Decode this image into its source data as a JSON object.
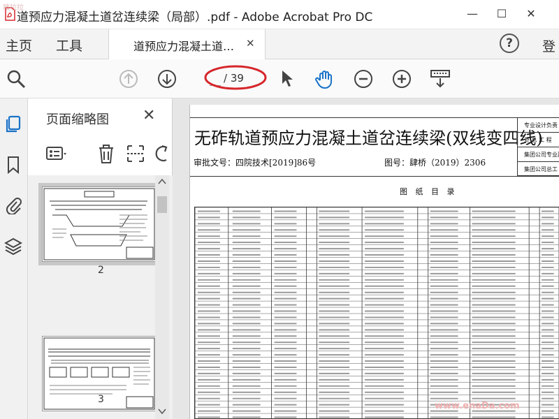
{
  "window": {
    "title": "道预应力混凝土道岔连续梁（局部）.pdf - Adobe Acrobat Pro DC",
    "watermark": "赌拉拉",
    "minimize_glyph": "—",
    "maximize_glyph": "☐",
    "close_glyph": "✕"
  },
  "tabs": {
    "home": "主页",
    "tools": "工具",
    "document": "道预应力混凝土道…",
    "document_close": "✕",
    "help": "?",
    "login": "登"
  },
  "toolbar": {
    "page_current": "",
    "page_total": "/ 39"
  },
  "thumbnail_panel": {
    "title": "页面缩略图",
    "close": "✕",
    "thumbnails": [
      {
        "page": "2"
      },
      {
        "page": "3"
      }
    ],
    "collapse_glyph": "◀"
  },
  "document": {
    "title": "无砟轨道预应力混凝土道岔连续梁(双线变四线)",
    "approval": "审批文号：四院技术[2019]86号",
    "drawing_no": "图号：肆桥（2019）2306",
    "subtitle": "图 纸 目 录",
    "signoff": [
      "专业设计负责",
      "处 总 工 程",
      "集团公司专业副",
      "集团公司总工"
    ]
  },
  "credit": "www.enaDa.com",
  "colors": {
    "accent_blue": "#1a73c8",
    "annotation_red": "#d6262b"
  }
}
